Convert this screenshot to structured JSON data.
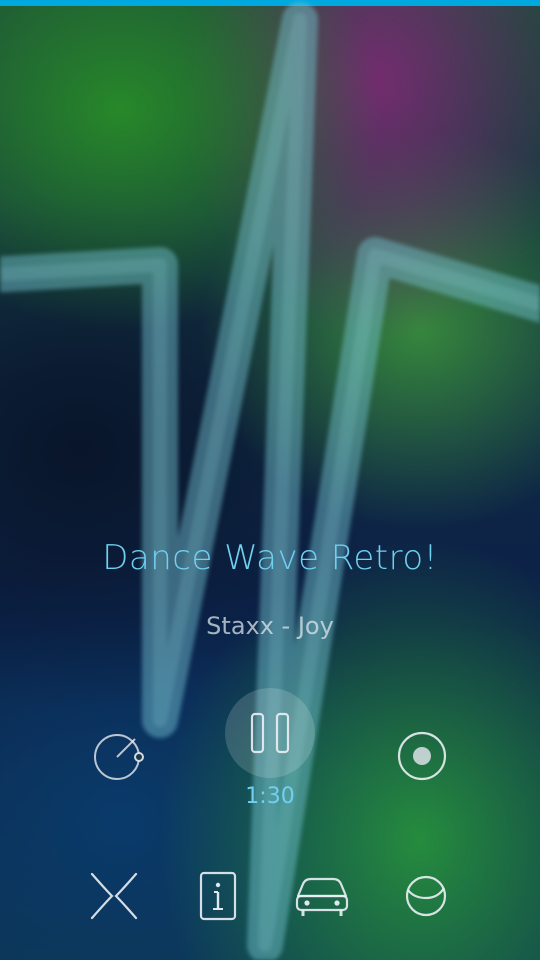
{
  "accent_color": "#00a8e0",
  "title_color": "#6fd0f0",
  "station": {
    "name": "Dance Wave Retro!",
    "now_playing": "Staxx - Joy"
  },
  "playback": {
    "state": "playing",
    "elapsed": "1:30"
  },
  "controls": {
    "left_icon": "tuner-dial-icon",
    "center_icon": "pause-icon",
    "right_icon": "record-icon"
  },
  "bottom_bar": [
    {
      "icon": "shuffle-icon"
    },
    {
      "icon": "info-icon"
    },
    {
      "icon": "car-icon"
    },
    {
      "icon": "sleep-timer-icon"
    }
  ]
}
